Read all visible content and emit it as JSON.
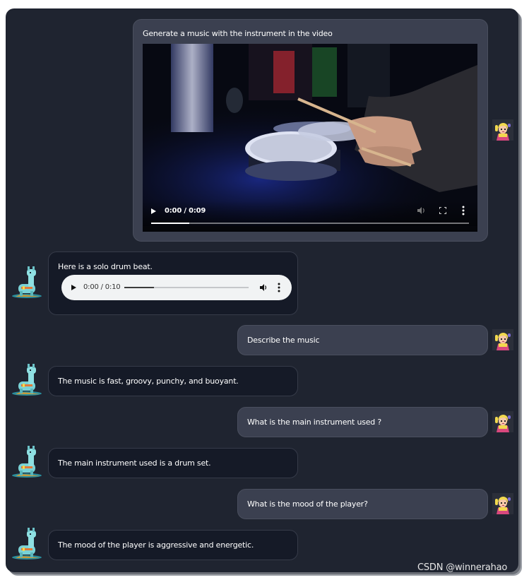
{
  "messages": [
    {
      "role": "user",
      "text": "Generate a music with the instrument in the video",
      "video": {
        "time": "0:00 / 0:09",
        "progress": 0.12
      }
    },
    {
      "role": "bot",
      "text": "Here is a solo drum beat.",
      "audio": {
        "time": "0:00 / 0:10",
        "progress": 0.24
      }
    },
    {
      "role": "user",
      "text": "Describe the music"
    },
    {
      "role": "bot",
      "text": "The music is fast, groovy, punchy, and buoyant."
    },
    {
      "role": "user",
      "text": "What is the main instrument used ?"
    },
    {
      "role": "bot",
      "text": "The main instrument used is a drum set."
    },
    {
      "role": "user",
      "text": "What is the mood of the player?"
    },
    {
      "role": "bot",
      "text": "The mood of the player is aggressive and energetic."
    }
  ],
  "avatars": {
    "user": "cartoon-girl-avatar-icon",
    "bot": "llama-avatar-icon"
  },
  "colors": {
    "background": "#1f2430",
    "user_bubble": "#3b4050",
    "bot_bubble": "#151a27"
  },
  "watermark": "CSDN @winnerahao"
}
